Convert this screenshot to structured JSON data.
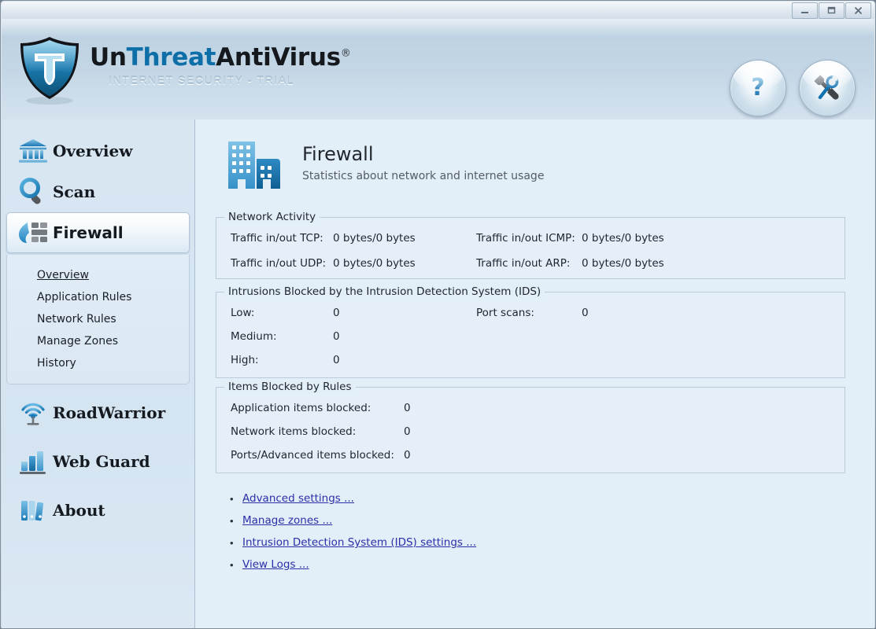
{
  "window": {
    "buttons": [
      {
        "name": "minimize",
        "label": "—"
      },
      {
        "name": "maximize",
        "label": "❐"
      },
      {
        "name": "close",
        "label": "✕"
      }
    ]
  },
  "branding": {
    "part_un": "Un",
    "part_threat": "Threat",
    "part_anti": "Anti",
    "part_virus": "Virus",
    "registered": "®",
    "subtitle": "INTERNET SECURITY - TRIAL"
  },
  "header_buttons": [
    {
      "name": "help-button",
      "icon": "question-mark-icon",
      "label": "?"
    },
    {
      "name": "tools-button",
      "icon": "tools-icon",
      "label": "Tools"
    }
  ],
  "sidebar": {
    "items": [
      {
        "label": "Overview",
        "icon": "bank-icon",
        "selected": false
      },
      {
        "label": "Scan",
        "icon": "magnifier-icon",
        "selected": false
      },
      {
        "label": "Firewall",
        "icon": "firewall-icon",
        "selected": true
      },
      {
        "label": "RoadWarrior",
        "icon": "wireless-icon",
        "selected": false
      },
      {
        "label": "Web Guard",
        "icon": "bar-chart-icon",
        "selected": false
      },
      {
        "label": "About",
        "icon": "books-icon",
        "selected": false
      }
    ],
    "submenu": [
      {
        "label": "Overview",
        "active": true
      },
      {
        "label": "Application Rules",
        "active": false
      },
      {
        "label": "Network Rules",
        "active": false
      },
      {
        "label": "Manage Zones",
        "active": false
      },
      {
        "label": "History",
        "active": false
      }
    ]
  },
  "page": {
    "icon": "buildings-icon",
    "title": "Firewall",
    "subtitle": "Statistics about network and internet usage"
  },
  "network_activity": {
    "legend": "Network Activity",
    "rows": [
      {
        "left_label": "Traffic in/out TCP:",
        "left_value": "0 bytes/0 bytes",
        "right_label": "Traffic in/out ICMP:",
        "right_value": "0 bytes/0 bytes"
      },
      {
        "left_label": "Traffic in/out UDP:",
        "left_value": "0 bytes/0 bytes",
        "right_label": "Traffic in/out ARP:",
        "right_value": "0 bytes/0 bytes"
      }
    ]
  },
  "intrusions": {
    "legend": "Intrusions Blocked by the Intrusion Detection System (IDS)",
    "rows": [
      {
        "left_label": "Low:",
        "left_value": "0",
        "right_label": "Port scans:",
        "right_value": "0"
      },
      {
        "left_label": "Medium:",
        "left_value": "0",
        "right_label": "",
        "right_value": ""
      },
      {
        "left_label": "High:",
        "left_value": "0",
        "right_label": "",
        "right_value": ""
      }
    ]
  },
  "items_blocked": {
    "legend": "Items Blocked by Rules",
    "rows": [
      {
        "left_label": "Application items blocked:",
        "left_value": "0"
      },
      {
        "left_label": "Network items blocked:",
        "left_value": "0"
      },
      {
        "left_label": "Ports/Advanced items blocked:",
        "left_value": "0"
      }
    ]
  },
  "links": [
    {
      "label": "Advanced settings ...",
      "bullet": "•"
    },
    {
      "label": "Manage zones ...",
      "bullet": "•"
    },
    {
      "label": "Intrusion Detection System (IDS) settings ...",
      "bullet": "•"
    },
    {
      "label": "View Logs ...",
      "bullet": "•"
    }
  ],
  "colors": {
    "accent": "#0d6ea8",
    "link": "#2b2fa8",
    "panel": "#e2eef8",
    "sidebar": "#d8e6f2",
    "border": "#b9cbdb"
  }
}
